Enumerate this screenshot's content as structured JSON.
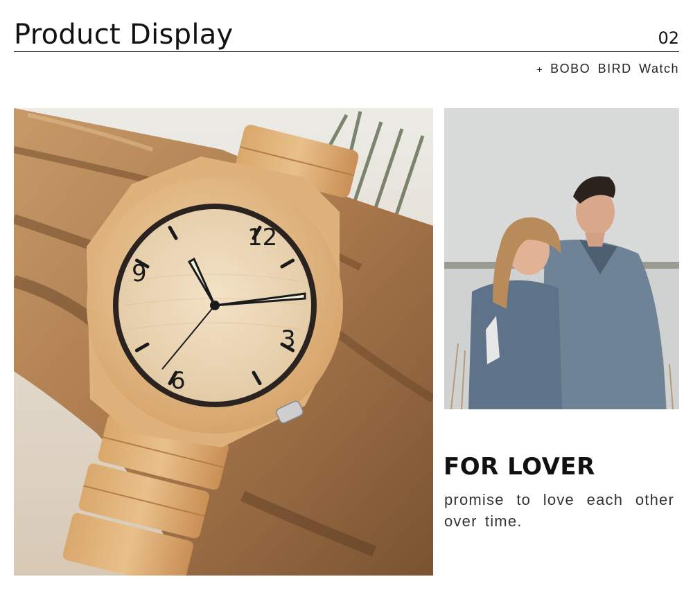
{
  "header": {
    "title": "Product Display",
    "page_number": "02",
    "brand_plus": "+",
    "brand": "BOBO BIRD Watch"
  },
  "watch_photo": {
    "subject": "wooden-watch-on-driftwood",
    "dial_numerals": [
      "12",
      "3",
      "6",
      "9"
    ]
  },
  "couple_photo": {
    "subject": "couple-in-denim-jackets"
  },
  "feature": {
    "headline": "FOR LOVER",
    "tagline": "promise to love each other over time."
  },
  "colors": {
    "wood_light": "#e8c699",
    "wood_mid": "#c9935a",
    "driftwood": "#b98a5c",
    "sky": "#d9dcdb",
    "denim": "#6f8396",
    "text": "#111111"
  }
}
